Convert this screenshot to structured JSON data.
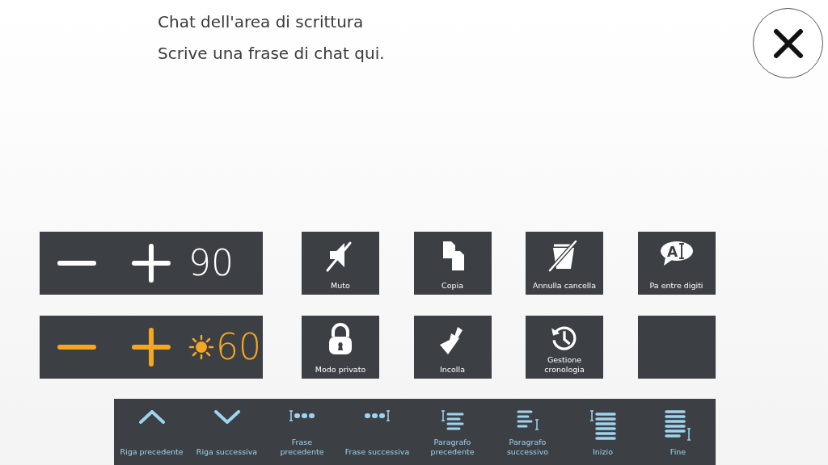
{
  "header": {
    "title": "Chat dell'area di scrittura",
    "subtitle": "Scrive una frase di chat qui."
  },
  "volume": {
    "value": "90"
  },
  "brightness": {
    "value": "60"
  },
  "tiles": [
    {
      "kind": "mute",
      "label": "Muto"
    },
    {
      "kind": "copy",
      "label": "Copia"
    },
    {
      "kind": "undo-delete",
      "label": "Annulla cancella"
    },
    {
      "kind": "bubble",
      "icon_text": "A",
      "label": "Pa entre digiti"
    },
    {
      "kind": "lock",
      "label": "Modo privato"
    },
    {
      "kind": "paste",
      "label": "Incolla"
    },
    {
      "kind": "history",
      "label": "Gestione cronologia"
    },
    {
      "kind": "empty"
    }
  ],
  "navigation": [
    {
      "kind": "up",
      "label": "Riga precedente"
    },
    {
      "kind": "down",
      "label": "Riga successiva"
    },
    {
      "kind": "sentence-prev",
      "label": "Frase precedente"
    },
    {
      "kind": "sentence-next",
      "label": "Frase successiva"
    },
    {
      "kind": "para-prev",
      "label": "Paragrafo precedente"
    },
    {
      "kind": "para-next",
      "label": "Paragrafo successivo"
    },
    {
      "kind": "start",
      "label": "Inizio"
    },
    {
      "kind": "end",
      "label": "Fine"
    }
  ]
}
